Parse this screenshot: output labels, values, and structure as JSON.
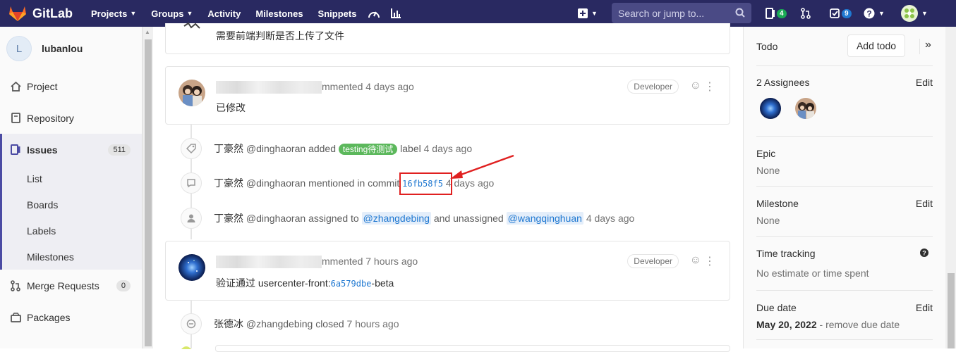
{
  "navbar": {
    "brand": "GitLab",
    "items": [
      "Projects",
      "Groups",
      "Activity",
      "Milestones",
      "Snippets"
    ],
    "search_placeholder": "Search or jump to...",
    "issues_count": "4",
    "todos_count": "9"
  },
  "sidebar": {
    "avatar_letter": "L",
    "project_name": "lubanlou",
    "items": [
      {
        "label": "Project"
      },
      {
        "label": "Repository"
      },
      {
        "label": "Issues",
        "count": "511"
      },
      {
        "label": "Merge Requests",
        "count": "0"
      },
      {
        "label": "Packages"
      }
    ],
    "issues_sub": [
      "List",
      "Boards",
      "Labels",
      "Milestones"
    ]
  },
  "timeline": {
    "note0_body": "需要前端判断是否上传了文件",
    "note1": {
      "head": "mmented",
      "time": "4 days ago",
      "role": "Developer",
      "body": "已修改"
    },
    "sys1": {
      "author": "丁豪然",
      "handle": "@dinghaoran",
      "action": "added",
      "label": "testing待测试",
      "rest": "label",
      "time": "4 days ago"
    },
    "sys2": {
      "author": "丁豪然",
      "handle": "@dinghaoran",
      "action": "mentioned in commit",
      "commit": "16fb58f5",
      "time": "4 days ago"
    },
    "sys3": {
      "author": "丁豪然",
      "handle": "@dinghaoran",
      "action": "assigned to",
      "mention1": "@zhangdebing",
      "mid": "and unassigned",
      "mention2": "@wangqinghuan",
      "time": "4 days ago"
    },
    "note2": {
      "head": "mmented",
      "time": "7 hours ago",
      "role": "Developer",
      "body_pre": "验证通过 usercenter-front:",
      "commit": "6a579dbe",
      "body_post": "-beta"
    },
    "sys4": {
      "author": "张德冰",
      "handle": "@zhangdebing",
      "action": "closed",
      "time": "7 hours ago"
    }
  },
  "right_sidebar": {
    "todo_label": "Todo",
    "add_todo": "Add todo",
    "assignees_title": "2 Assignees",
    "edit": "Edit",
    "epic_title": "Epic",
    "epic_value": "None",
    "milestone_title": "Milestone",
    "milestone_value": "None",
    "time_title": "Time tracking",
    "time_value": "No estimate or time spent",
    "due_title": "Due date",
    "due_value": "May 20, 2022",
    "due_remove": "- remove due date"
  },
  "colors": {
    "navbar": "#292961",
    "accent": "#4b4ba3",
    "label_green": "#5cb85c",
    "link": "#1f78d1",
    "highlight": "#e02020"
  }
}
